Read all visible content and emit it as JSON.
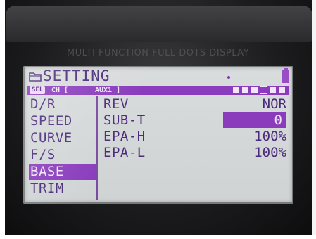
{
  "bezel": {
    "label": "MULTI FUNCTION FULL DOTS DISPLAY"
  },
  "header": {
    "title": "SETTING"
  },
  "selection_bar": {
    "sel_label": "SEL",
    "channel_label": "CH [",
    "channel_value": "AUX1 ]"
  },
  "menu": {
    "items": [
      {
        "label": "D/R"
      },
      {
        "label": "SPEED"
      },
      {
        "label": "CURVE"
      },
      {
        "label": "F/S"
      },
      {
        "label": "BASE",
        "active": true
      },
      {
        "label": "TRIM"
      }
    ]
  },
  "params": [
    {
      "name": "REV",
      "value": "NOR"
    },
    {
      "name": "SUB-T",
      "value": "0",
      "highlighted": true
    },
    {
      "name": "EPA-H",
      "value": "100%"
    },
    {
      "name": "EPA-L",
      "value": "100%"
    }
  ],
  "colors": {
    "lcd_background": "#d4d7d7",
    "lcd_text": "#4a2a7a",
    "accent": "#8a3cbc"
  },
  "icons": [
    "folder-icon",
    "battery-icon",
    "indicator-dot-icon"
  ]
}
